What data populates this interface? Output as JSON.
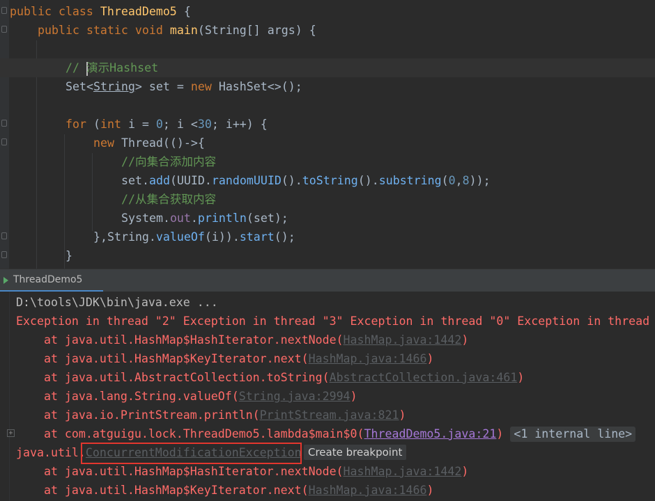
{
  "editor": {
    "lines": [
      {
        "id": "l1",
        "parts": [
          [
            "kw",
            "public "
          ],
          [
            "kw",
            "class "
          ],
          [
            "fn",
            "ThreadDemo5"
          ],
          [
            "",
            "{"
          ]
        ],
        "plain_spaced": true
      },
      {
        "id": "l2"
      },
      {
        "id": "l3"
      }
    ],
    "text": {
      "l1_public": "public",
      "l1_class": "class",
      "l1_name": "ThreadDemo5",
      "l1_brace": "{",
      "l2_public": "public",
      "l2_static": "static",
      "l2_void": "void",
      "l2_main": "main",
      "l2_args": "(String[] args) {",
      "l4_comment_prefix": "// ",
      "l4_comment_text": "演示Hashset",
      "l5_set": "Set<",
      "l5_string": "String",
      "l5_rest1": "> set = ",
      "l5_new": "new ",
      "l5_rest2": "HashSet<>();",
      "l7_for": "for ",
      "l7_paren": "(",
      "l7_int": "int ",
      "l7_i": "i = ",
      "l7_zero": "0",
      "l7_semi": "; i <",
      "l7_thirty": "30",
      "l7_end": "; i++) {",
      "l8_new": "new ",
      "l8_rest": "Thread(()->{",
      "l9_comment": "//向集合添加内容",
      "l10_a": "set.",
      "l10_add": "add",
      "l10_b": "(UUID.",
      "l10_rand": "randomUUID",
      "l10_c": "().",
      "l10_ts": "toString",
      "l10_d": "().",
      "l10_sub": "substring",
      "l10_e": "(",
      "l10_n0": "0",
      "l10_f": ",",
      "l10_n8": "8",
      "l10_g": "));",
      "l11_comment": "//从集合获取内容",
      "l12_a": "System.",
      "l12_out": "out",
      "l12_b": ".",
      "l12_println": "println",
      "l12_c": "(set);",
      "l13_a": "},String.",
      "l13_valueof": "valueOf",
      "l13_b": "(i)).",
      "l13_start": "start",
      "l13_c": "();",
      "l14": "}"
    }
  },
  "run_panel": {
    "tab_label": "ThreadDemo5"
  },
  "console": {
    "cmd": "D:\\tools\\JDK\\bin\\java.exe ...",
    "exception_line": "Exception in thread \"2\" Exception in thread \"3\" Exception in thread \"0\" Exception in thread",
    "frames": [
      {
        "prefix": "    at java.util.HashMap$HashIterator.nextNode(",
        "link": "HashMap.java:1442",
        "suffix": ")"
      },
      {
        "prefix": "    at java.util.HashMap$KeyIterator.next(",
        "link": "HashMap.java:1466",
        "suffix": ")"
      },
      {
        "prefix": "    at java.util.AbstractCollection.toString(",
        "link": "AbstractCollection.java:461",
        "suffix": ")"
      },
      {
        "prefix": "    at java.lang.String.valueOf(",
        "link": "String.java:2994",
        "suffix": ")"
      },
      {
        "prefix": "    at java.io.PrintStream.println(",
        "link": "PrintStream.java:821",
        "suffix": ")"
      },
      {
        "prefix": "    at com.atguigu.lock.ThreadDemo5.lambda$main$0(",
        "link": "ThreadDemo5.java:21",
        "suffix": ") "
      }
    ],
    "internal_line": "<1 internal line>",
    "exc_pkg": "java.util.",
    "exc_name": "ConcurrentModificationException",
    "breakpoint_popup": "Create breakpoint",
    "frames2": [
      {
        "prefix": "    at java.util.HashMap$HashIterator.nextNode(",
        "link": "HashMap.java:1442",
        "suffix": ")"
      },
      {
        "prefix": "    at java.util.HashMap$KeyIterator.next(",
        "link": "HashMap.java:1466",
        "suffix": ")"
      }
    ]
  }
}
